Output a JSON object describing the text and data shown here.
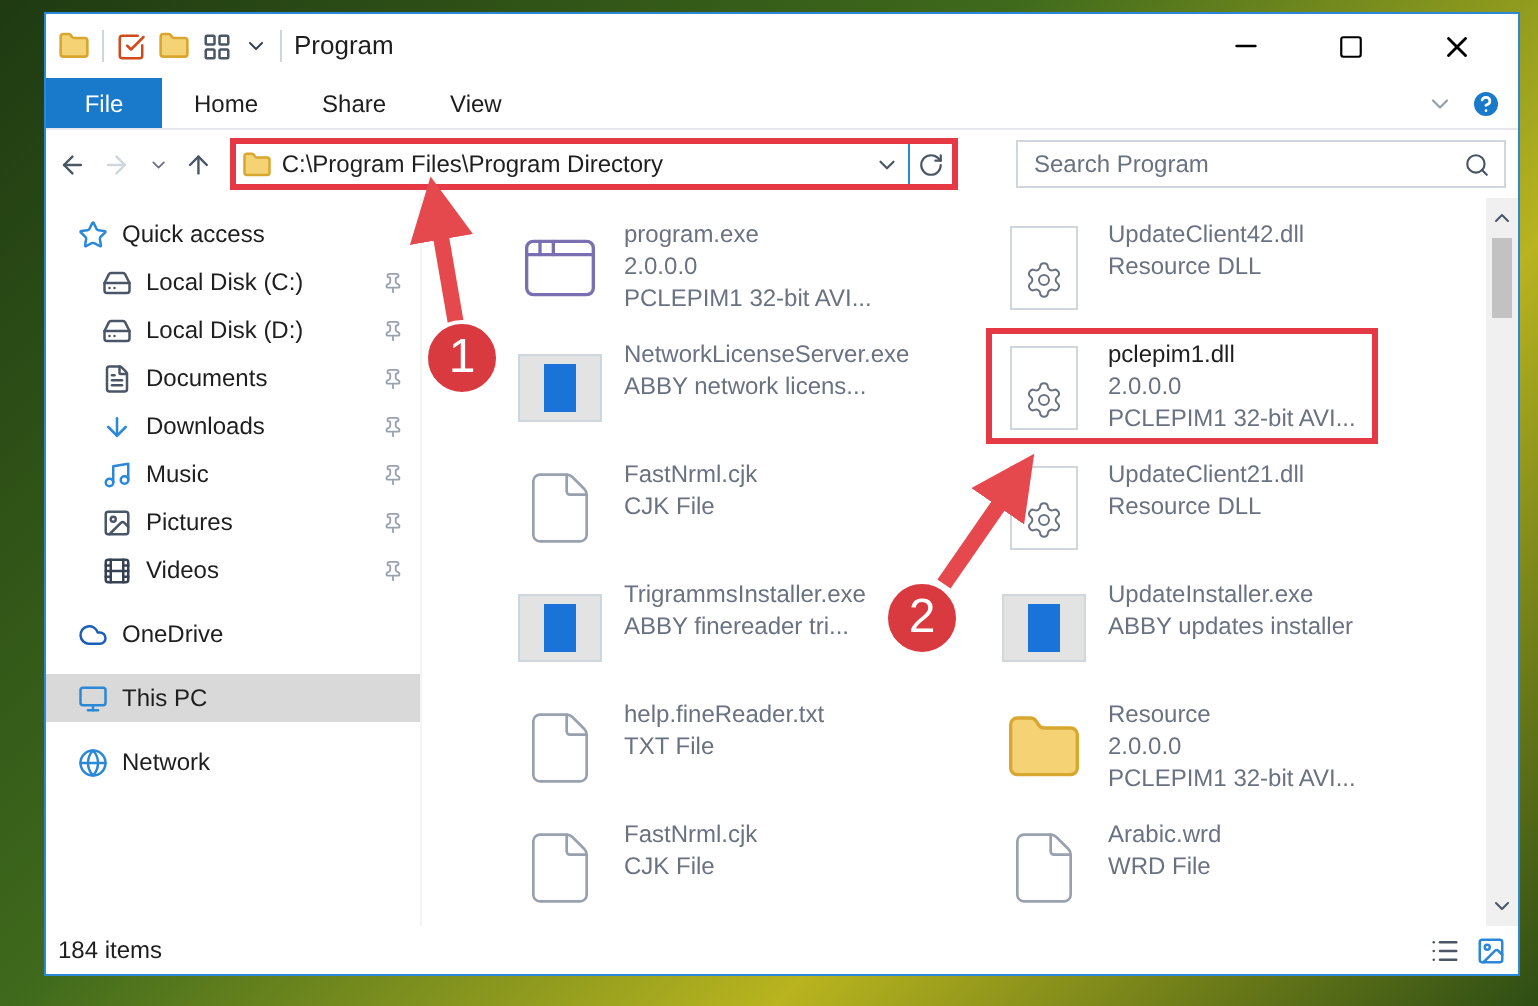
{
  "window": {
    "title": "Program"
  },
  "ribbon_tabs": [
    {
      "label": "File",
      "selected": true
    },
    {
      "label": "Home",
      "selected": false
    },
    {
      "label": "Share",
      "selected": false
    },
    {
      "label": "View",
      "selected": false
    }
  ],
  "address_bar": {
    "path": "C:\\Program Files\\Program Directory",
    "highlighted": true
  },
  "search": {
    "placeholder": "Search Program"
  },
  "sidebar": {
    "items": [
      {
        "label": "Quick access",
        "kind": "star",
        "selected": false,
        "children": [
          {
            "label": "Local Disk (C:)",
            "kind": "disk",
            "selected": false,
            "pinned": true
          },
          {
            "label": "Local Disk (D:)",
            "kind": "disk",
            "selected": false,
            "pinned": true
          },
          {
            "label": "Documents",
            "kind": "documents",
            "selected": false,
            "pinned": true
          },
          {
            "label": "Downloads",
            "kind": "downloads",
            "selected": false,
            "pinned": true
          },
          {
            "label": "Music",
            "kind": "music",
            "selected": false,
            "pinned": true
          },
          {
            "label": "Pictures",
            "kind": "pictures",
            "selected": false,
            "pinned": true
          },
          {
            "label": "Videos",
            "kind": "videos",
            "selected": false,
            "pinned": true
          }
        ]
      },
      {
        "label": "OneDrive",
        "kind": "cloud",
        "selected": false
      },
      {
        "label": "This PC",
        "kind": "pc",
        "selected": true
      },
      {
        "label": "Network",
        "kind": "network",
        "selected": false
      }
    ]
  },
  "files": [
    {
      "name": "program.exe",
      "details": [
        "2.0.0.0",
        "PCLEPIM1 32-bit AVI..."
      ],
      "kind": "program",
      "highlighted": false
    },
    {
      "name": "UpdateClient42.dll",
      "details": [
        "Resource DLL"
      ],
      "kind": "dll",
      "highlighted": false
    },
    {
      "name": "NetworkLicenseServer.exe",
      "details": [
        "ABBY network licens..."
      ],
      "kind": "app",
      "highlighted": false
    },
    {
      "name": "pclepim1.dll",
      "details": [
        "2.0.0.0",
        "PCLEPIM1 32-bit AVI..."
      ],
      "kind": "dll",
      "highlighted": true
    },
    {
      "name": "FastNrml.cjk",
      "details": [
        "CJK File"
      ],
      "kind": "blank",
      "highlighted": false
    },
    {
      "name": "UpdateClient21.dll",
      "details": [
        "Resource DLL"
      ],
      "kind": "dll",
      "highlighted": false
    },
    {
      "name": "TrigrammsInstaller.exe",
      "details": [
        "ABBY finereader tri..."
      ],
      "kind": "app",
      "highlighted": false
    },
    {
      "name": "UpdateInstaller.exe",
      "details": [
        "ABBY updates installer"
      ],
      "kind": "app",
      "highlighted": false
    },
    {
      "name": "help.fineReader.txt",
      "details": [
        "TXT File"
      ],
      "kind": "blank",
      "highlighted": false
    },
    {
      "name": "Resource",
      "details": [
        "2.0.0.0",
        "PCLEPIM1 32-bit AVI..."
      ],
      "kind": "folder",
      "highlighted": false
    },
    {
      "name": "FastNrml.cjk",
      "details": [
        "CJK File"
      ],
      "kind": "blank",
      "highlighted": false
    },
    {
      "name": "Arabic.wrd",
      "details": [
        "WRD File"
      ],
      "kind": "blank",
      "highlighted": false
    }
  ],
  "status_bar": {
    "item_count": "184 items"
  },
  "annotations": [
    {
      "label": "1"
    },
    {
      "label": "2"
    }
  ]
}
